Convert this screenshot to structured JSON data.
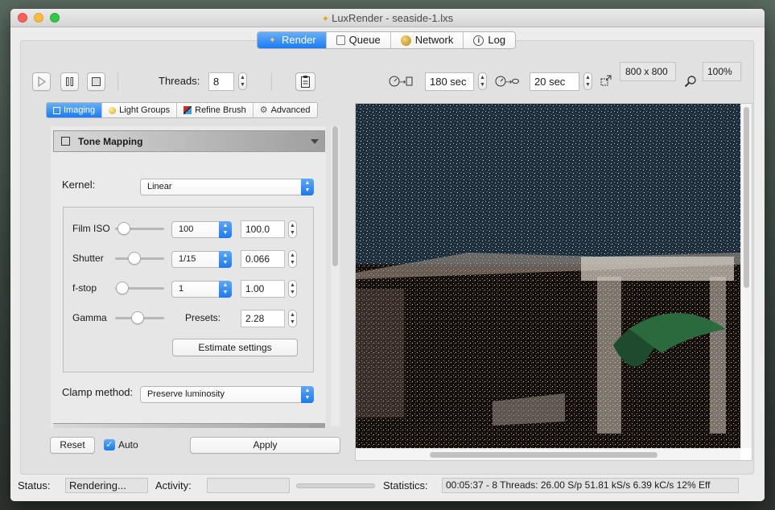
{
  "window": {
    "title": "LuxRender - seaside-1.lxs"
  },
  "main_tabs": [
    {
      "label": "Render",
      "active": true,
      "icon": "render-icon"
    },
    {
      "label": "Queue",
      "active": false,
      "icon": "queue-icon"
    },
    {
      "label": "Network",
      "active": false,
      "icon": "network-icon"
    },
    {
      "label": "Log",
      "active": false,
      "icon": "info-icon"
    }
  ],
  "toolbar": {
    "threads_label": "Threads:",
    "threads_value": "8",
    "halt_time": "180 sec",
    "display_interval": "20 sec",
    "resolution": "800 x 800",
    "zoom": "100%"
  },
  "sub_tabs": [
    {
      "label": "Imaging",
      "active": true
    },
    {
      "label": "Light Groups",
      "active": false
    },
    {
      "label": "Refine Brush",
      "active": false
    },
    {
      "label": "Advanced",
      "active": false
    }
  ],
  "tone_mapping": {
    "title": "Tone Mapping",
    "kernel_label": "Kernel:",
    "kernel_value": "Linear",
    "film_iso_label": "Film ISO",
    "film_iso_select": "100",
    "film_iso_value": "100.0",
    "shutter_label": "Shutter",
    "shutter_select": "1/15",
    "shutter_value": "0.066",
    "fstop_label": "f-stop",
    "fstop_select": "1",
    "fstop_value": "1.00",
    "gamma_label": "Gamma",
    "presets_label": "Presets:",
    "gamma_value": "2.28",
    "estimate_button": "Estimate settings",
    "clamp_label": "Clamp method:",
    "clamp_value": "Preserve luminosity"
  },
  "bottom_controls": {
    "reset": "Reset",
    "auto": "Auto",
    "auto_checked": true,
    "apply": "Apply"
  },
  "status": {
    "status_label": "Status:",
    "status_value": "Rendering...",
    "activity_label": "Activity:",
    "statistics_label": "Statistics:",
    "statistics_value": "00:05:37 - 8 Threads: 26.00 S/p 51.81 kS/s 6.39 kC/s 12% Eff"
  }
}
